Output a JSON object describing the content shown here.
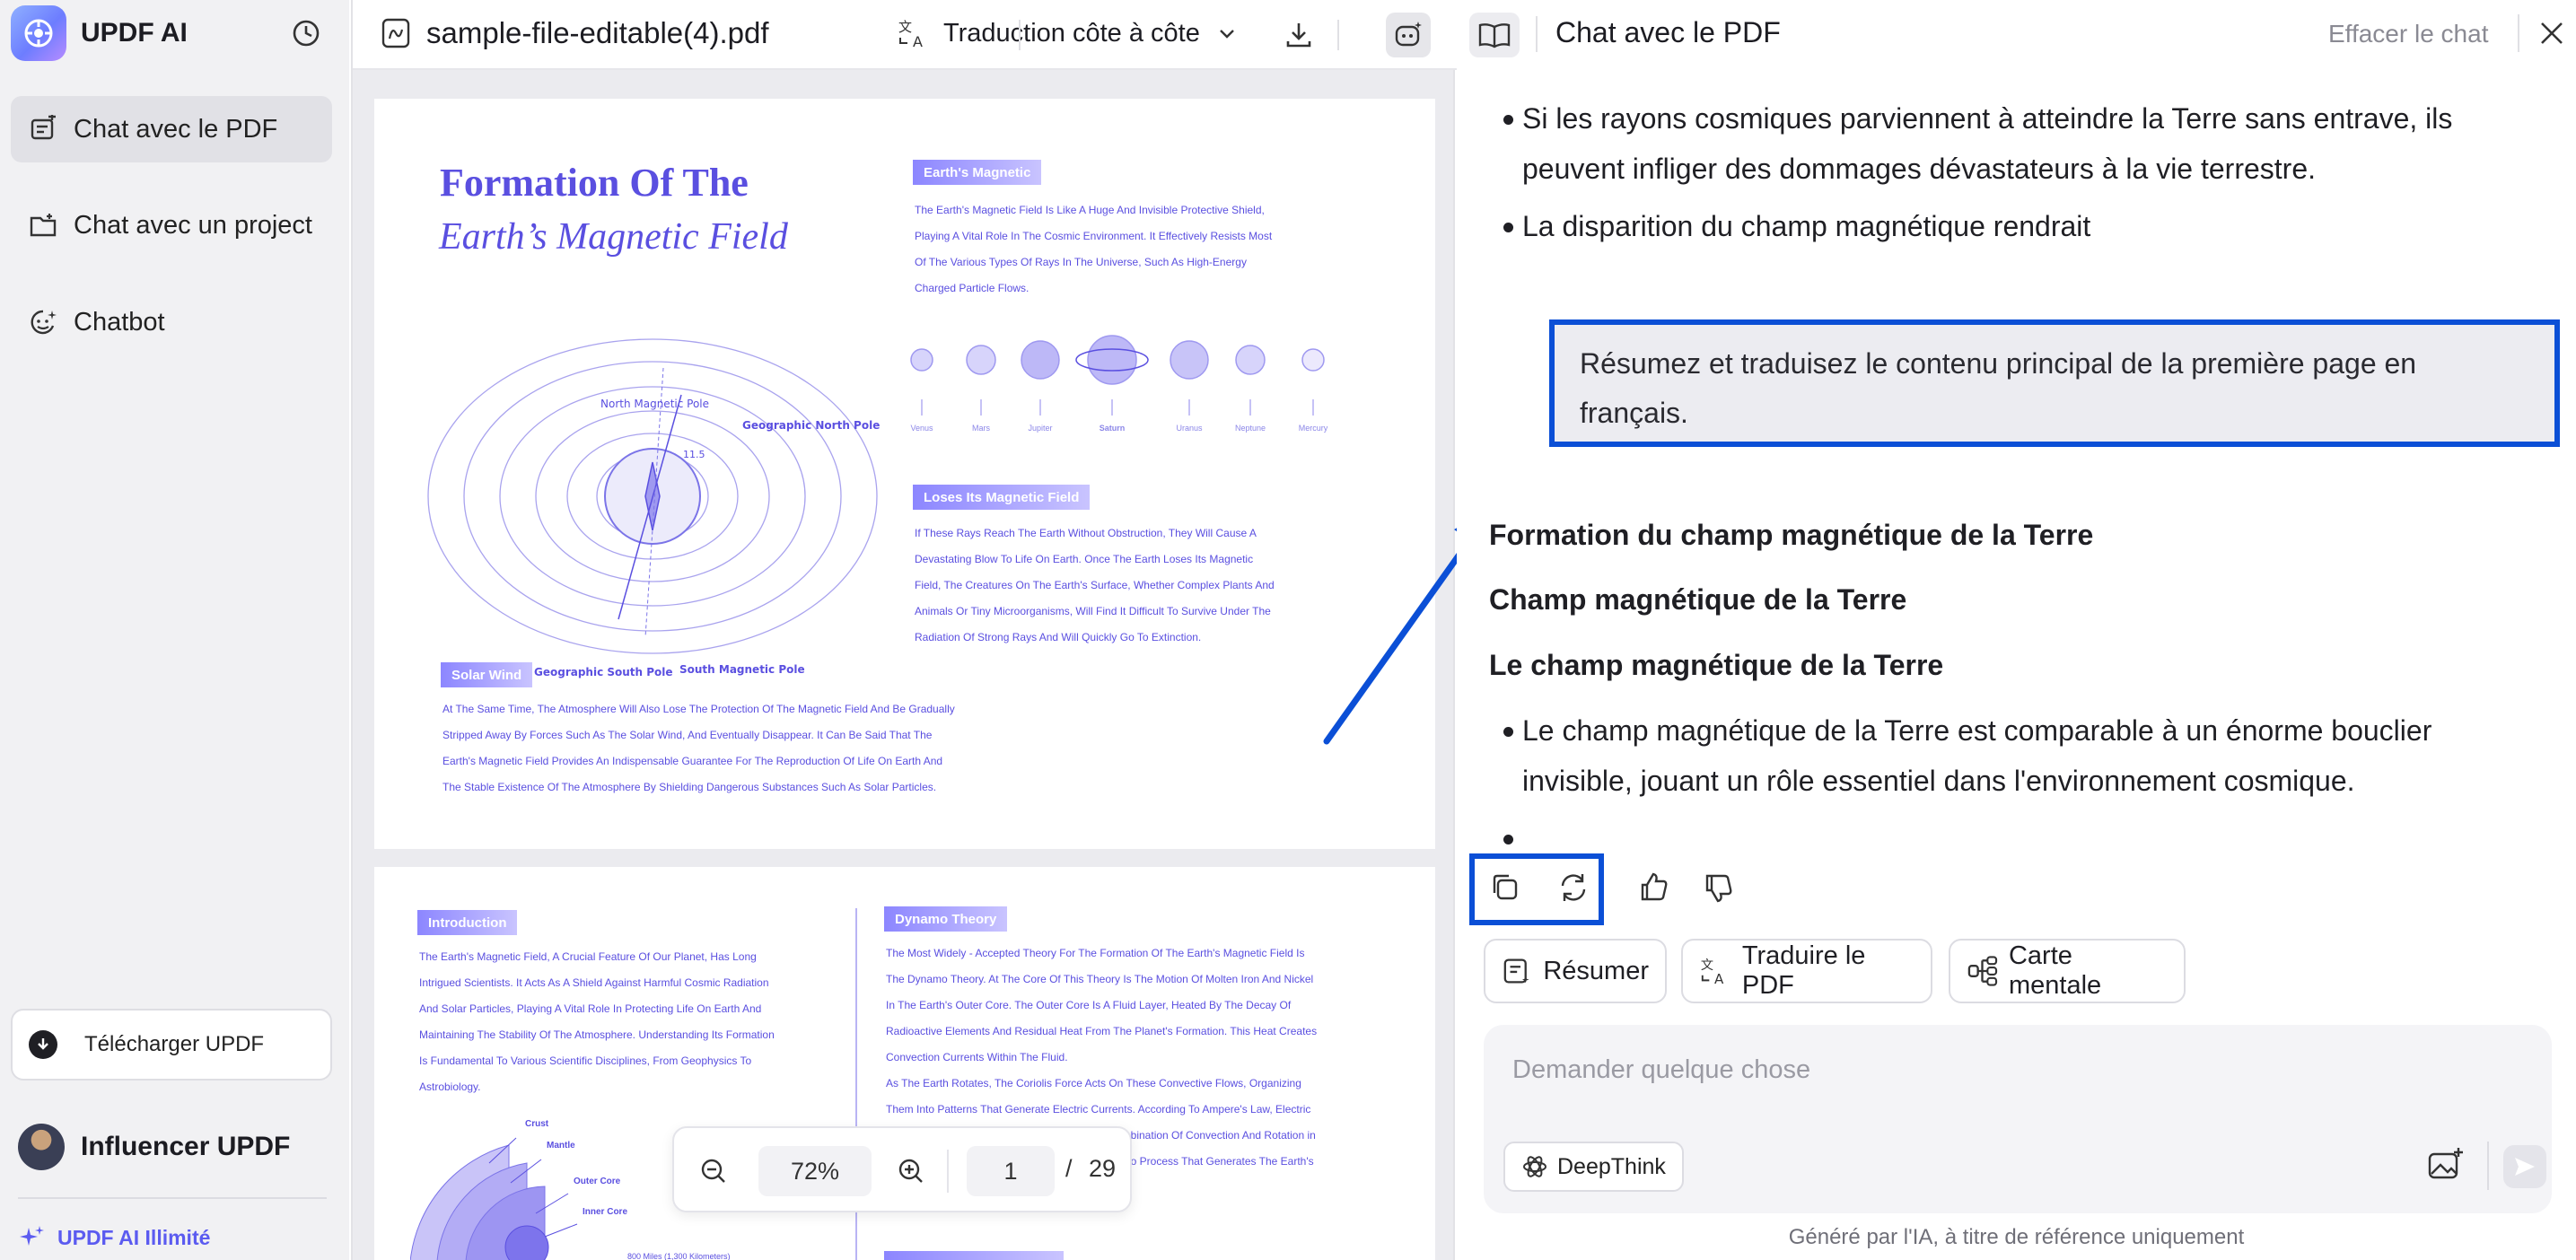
{
  "sidebar": {
    "brand": "UPDF AI",
    "items": [
      {
        "label": "Chat avec le PDF",
        "active": true
      },
      {
        "label": "Chat avec un project",
        "active": false
      },
      {
        "label": "Chatbot",
        "active": false
      }
    ],
    "download_label": "Télécharger UPDF",
    "user_name": "Influencer UPDF",
    "plan_label": "UPDF AI Illimité"
  },
  "toolbar": {
    "file_name": "sample-file-editable(4).pdf",
    "translate_mode": "Traduction côte à côte"
  },
  "pdf": {
    "page1": {
      "title_line1": "Formation Of The",
      "title_line2": "Earth’s Magnetic Field",
      "diagram_labels": {
        "north_magnetic": "North\nMagnetic Pole",
        "geo_north": "Geographic\nNorth Pole",
        "angle": "11.5",
        "geo_south": "Geographic\nSouth Pole",
        "south_magnetic": "South\nMagnetic\nPole"
      },
      "earths_magnetic_tag": "Earth's Magnetic",
      "earths_magnetic_text": [
        "The Earth's Magnetic Field Is Like A Huge And Invisible Protective Shield,",
        "Playing A Vital Role In The Cosmic Environment. It Effectively Resists Most",
        "Of The Various Types Of Rays In The Universe, Such As High-Energy",
        "Charged Particle Flows."
      ],
      "planets": [
        "Venus",
        "Mars",
        "Jupiter",
        "Saturn",
        "Uranus",
        "Neptune",
        "Mercury"
      ],
      "loses_tag": "Loses Its Magnetic Field",
      "loses_text": [
        "If These Rays Reach The Earth Without Obstruction, They Will Cause A",
        "Devastating Blow To Life On Earth. Once The Earth Loses Its Magnetic",
        "Field, The Creatures On The Earth's Surface, Whether Complex Plants And",
        "Animals Or Tiny Microorganisms, Will Find It Difficult To Survive Under The",
        "Radiation Of Strong Rays And Will Quickly Go To Extinction."
      ],
      "solar_tag": "Solar Wind",
      "solar_text": [
        "At The Same Time, The Atmosphere Will Also Lose The Protection Of The Magnetic Field And Be Gradually",
        "Stripped Away By Forces Such As The Solar Wind, And Eventually Disappear. It Can Be Said That The",
        "Earth's Magnetic Field Provides An Indispensable Guarantee For The Reproduction Of Life On Earth And",
        "The Stable Existence Of The Atmosphere By Shielding Dangerous Substances Such As Solar Particles."
      ]
    },
    "page2": {
      "intro_tag": "Introduction",
      "intro_text": [
        "The Earth's Magnetic Field, A Crucial Feature Of Our Planet, Has Long",
        "Intrigued Scientists. It Acts As A Shield Against Harmful Cosmic Radiation",
        "And Solar Particles, Playing A Vital Role In Protecting Life On Earth And",
        "Maintaining The Stability Of The Atmosphere. Understanding Its Formation",
        "Is Fundamental To Various Scientific Disciplines, From Geophysics To",
        "Astrobiology."
      ],
      "dynamo_tag": "Dynamo Theory",
      "dynamo_text": [
        "The Most Widely - Accepted Theory For The Formation Of The Earth's Magnetic Field Is",
        "The Dynamo Theory. At The Core Of This Theory Is The Motion Of Molten Iron And Nickel",
        "In The Earth's Outer Core. The Outer Core Is A Fluid Layer, Heated By The Decay Of",
        "Radioactive Elements And Residual Heat From The Planet's Formation. This Heat Creates",
        "Convection Currents Within The Fluid.",
        "As The Earth Rotates, The Coriolis Force Acts On These Convective Flows, Organizing",
        "Them Into Patterns That Generate Electric Currents. According To Ampere's Law, Electric",
        "ombination Of Convection And Rotation in",
        "amo Process That Generates The Earth's"
      ],
      "layers": [
        "Crust",
        "Mantle",
        "Outer Core",
        "Inner Core"
      ],
      "distance": "800 Miles (1,300 Kilometers)"
    }
  },
  "zoom": {
    "value": "72%",
    "page": "1",
    "separator": "/",
    "total": "29"
  },
  "chat": {
    "title": "Chat avec le PDF",
    "clear_label": "Effacer le chat",
    "prev_bullets": [
      "Si les rayons cosmiques parviennent à atteindre la Terre sans entrave, ils peuvent infliger des dommages dévastateurs à la vie terrestre.",
      "La disparition du champ magnétique rendrait"
    ],
    "user_message": "Résumez et traduisez le contenu principal de la première page en français.",
    "answer_heading1": "Formation du champ magnétique de la Terre",
    "answer_heading2": "Champ magnétique de la Terre",
    "answer_heading3": "Le champ magnétique de la Terre",
    "answer_bullet": "Le champ magnétique de la Terre est comparable à un énorme bouclier invisible, jouant un rôle essentiel dans l'environnement cosmique.",
    "quick_actions": [
      "Résumer",
      "Traduire le PDF",
      "Carte mentale"
    ],
    "input_placeholder": "Demander quelque chose",
    "deepthink_label": "DeepThink",
    "footer_note": "Généré par l'IA, à titre de référence uniquement"
  },
  "colors": {
    "accent": "#5a4fe0",
    "highlight": "#0b4fd6",
    "brand": "#6d7dff"
  }
}
